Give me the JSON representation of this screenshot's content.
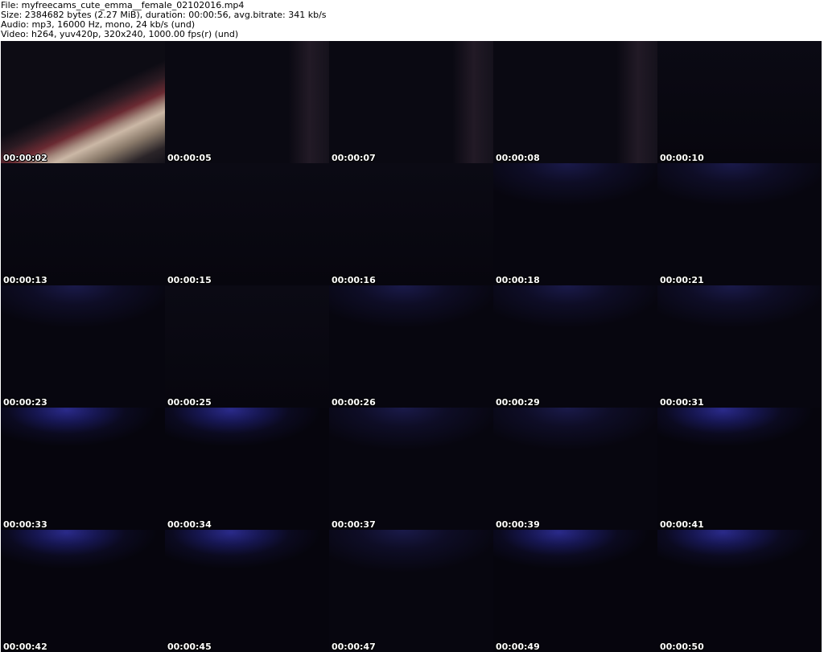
{
  "header": {
    "file_line": "File: myfreecams_cute_emma__female_02102016.mp4",
    "size_line": "Size: 2384682 bytes (2.27 MiB), duration: 00:00:56, avg.bitrate: 341 kb/s",
    "audio_line": "Audio: mp3, 16000 Hz, mono, 24 kb/s (und)",
    "video_line": "Video: h264, yuv420p, 320x240, 1000.00 fps(r) (und)"
  },
  "thumbnails": [
    {
      "timestamp": "00:00:02",
      "style": "arm"
    },
    {
      "timestamp": "00:00:05",
      "style": "dark-edge"
    },
    {
      "timestamp": "00:00:07",
      "style": "dark-edge"
    },
    {
      "timestamp": "00:00:08",
      "style": "dark-edge"
    },
    {
      "timestamp": "00:00:10",
      "style": "dark"
    },
    {
      "timestamp": "00:00:13",
      "style": "dark"
    },
    {
      "timestamp": "00:00:15",
      "style": "dark"
    },
    {
      "timestamp": "00:00:16",
      "style": "dark"
    },
    {
      "timestamp": "00:00:18",
      "style": "faint-blue"
    },
    {
      "timestamp": "00:00:21",
      "style": "faint-blue"
    },
    {
      "timestamp": "00:00:23",
      "style": "faint-blue"
    },
    {
      "timestamp": "00:00:25",
      "style": "dark"
    },
    {
      "timestamp": "00:00:26",
      "style": "faint-blue"
    },
    {
      "timestamp": "00:00:29",
      "style": "faint-blue"
    },
    {
      "timestamp": "00:00:31",
      "style": "faint-blue"
    },
    {
      "timestamp": "00:00:33",
      "style": "blue"
    },
    {
      "timestamp": "00:00:34",
      "style": "blue"
    },
    {
      "timestamp": "00:00:37",
      "style": "faint-blue"
    },
    {
      "timestamp": "00:00:39",
      "style": "faint-blue"
    },
    {
      "timestamp": "00:00:41",
      "style": "blue"
    },
    {
      "timestamp": "00:00:42",
      "style": "blue"
    },
    {
      "timestamp": "00:00:45",
      "style": "blue"
    },
    {
      "timestamp": "00:00:47",
      "style": "faint-blue"
    },
    {
      "timestamp": "00:00:49",
      "style": "blue"
    },
    {
      "timestamp": "00:00:50",
      "style": "blue"
    }
  ]
}
